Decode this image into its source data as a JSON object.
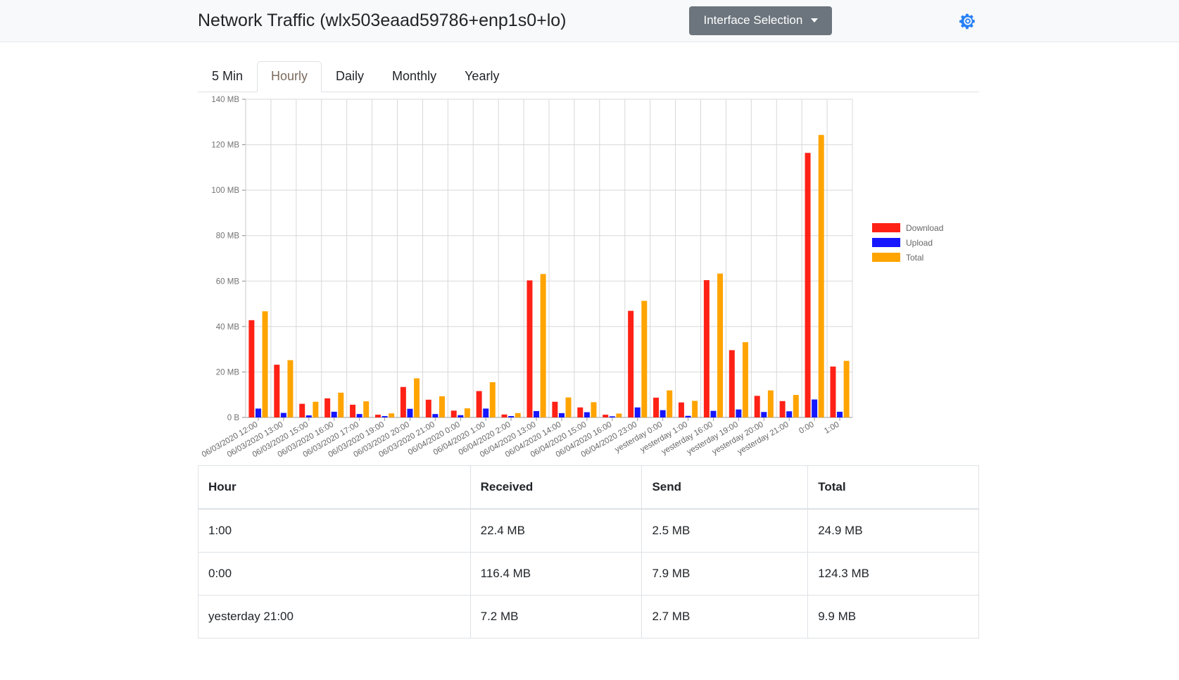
{
  "header": {
    "title": "Network Traffic (wlx503eaad59786+enp1s0+lo)",
    "interface_button_label": "Interface Selection",
    "settings_icon": "gear-icon",
    "accent_color": "#2680f7",
    "button_color": "#6c757d"
  },
  "tabs": [
    {
      "label": "5 Min",
      "active": false
    },
    {
      "label": "Hourly",
      "active": true
    },
    {
      "label": "Daily",
      "active": false
    },
    {
      "label": "Monthly",
      "active": false
    },
    {
      "label": "Yearly",
      "active": false
    }
  ],
  "chart_data": {
    "type": "bar",
    "title": "",
    "xlabel": "",
    "ylabel": "",
    "ylim": [
      0,
      140
    ],
    "yunit": "MB",
    "grid": true,
    "legend_position": "right",
    "ytick_labels": [
      "140 MB",
      "120 MB",
      "100 MB",
      "80 MB",
      "60 MB",
      "40 MB",
      "20 MB",
      "0 B"
    ],
    "ytick_values": [
      140,
      120,
      100,
      80,
      60,
      40,
      20,
      0
    ],
    "categories": [
      "06/03/2020 12:00",
      "06/03/2020 13:00",
      "06/03/2020 15:00",
      "06/03/2020 16:00",
      "06/03/2020 17:00",
      "06/03/2020 19:00",
      "06/03/2020 20:00",
      "06/03/2020 21:00",
      "06/04/2020 0:00",
      "06/04/2020 1:00",
      "06/04/2020 2:00",
      "06/04/2020 13:00",
      "06/04/2020 14:00",
      "06/04/2020 15:00",
      "06/04/2020 16:00",
      "06/04/2020 23:00",
      "yesterday 0:00",
      "yesterday 1:00",
      "yesterday 16:00",
      "yesterday 19:00",
      "yesterday 20:00",
      "yesterday 21:00",
      "0:00",
      "1:00"
    ],
    "series": [
      {
        "name": "Download",
        "color": "#ff2116",
        "values": [
          42.8,
          23.2,
          6.0,
          8.4,
          5.6,
          1.2,
          13.4,
          7.8,
          3.0,
          11.6,
          1.3,
          60.3,
          6.9,
          4.4,
          1.2,
          46.9,
          8.7,
          6.6,
          60.4,
          29.6,
          9.5,
          7.2,
          116.4,
          22.4
        ]
      },
      {
        "name": "Upload",
        "color": "#1616ff",
        "values": [
          3.9,
          2.0,
          0.9,
          2.5,
          1.5,
          0.6,
          3.8,
          1.5,
          1.0,
          3.9,
          0.6,
          2.8,
          1.9,
          2.3,
          0.5,
          4.4,
          3.2,
          0.7,
          2.9,
          3.5,
          2.4,
          2.7,
          7.9,
          2.5
        ]
      },
      {
        "name": "Total",
        "color": "#ffa400",
        "values": [
          46.7,
          25.2,
          6.9,
          10.9,
          7.1,
          1.8,
          17.2,
          9.3,
          4.0,
          15.5,
          1.9,
          63.1,
          8.8,
          6.7,
          1.7,
          51.3,
          11.9,
          7.3,
          63.3,
          33.1,
          11.9,
          9.9,
          124.3,
          24.9
        ]
      }
    ]
  },
  "table": {
    "columns": [
      "Hour",
      "Received",
      "Send",
      "Total"
    ],
    "rows": [
      {
        "hour": "1:00",
        "received": "22.4 MB",
        "send": "2.5 MB",
        "total": "24.9 MB"
      },
      {
        "hour": "0:00",
        "received": "116.4 MB",
        "send": "7.9 MB",
        "total": "124.3 MB"
      },
      {
        "hour": "yesterday 21:00",
        "received": "7.2 MB",
        "send": "2.7 MB",
        "total": "9.9 MB"
      }
    ]
  }
}
